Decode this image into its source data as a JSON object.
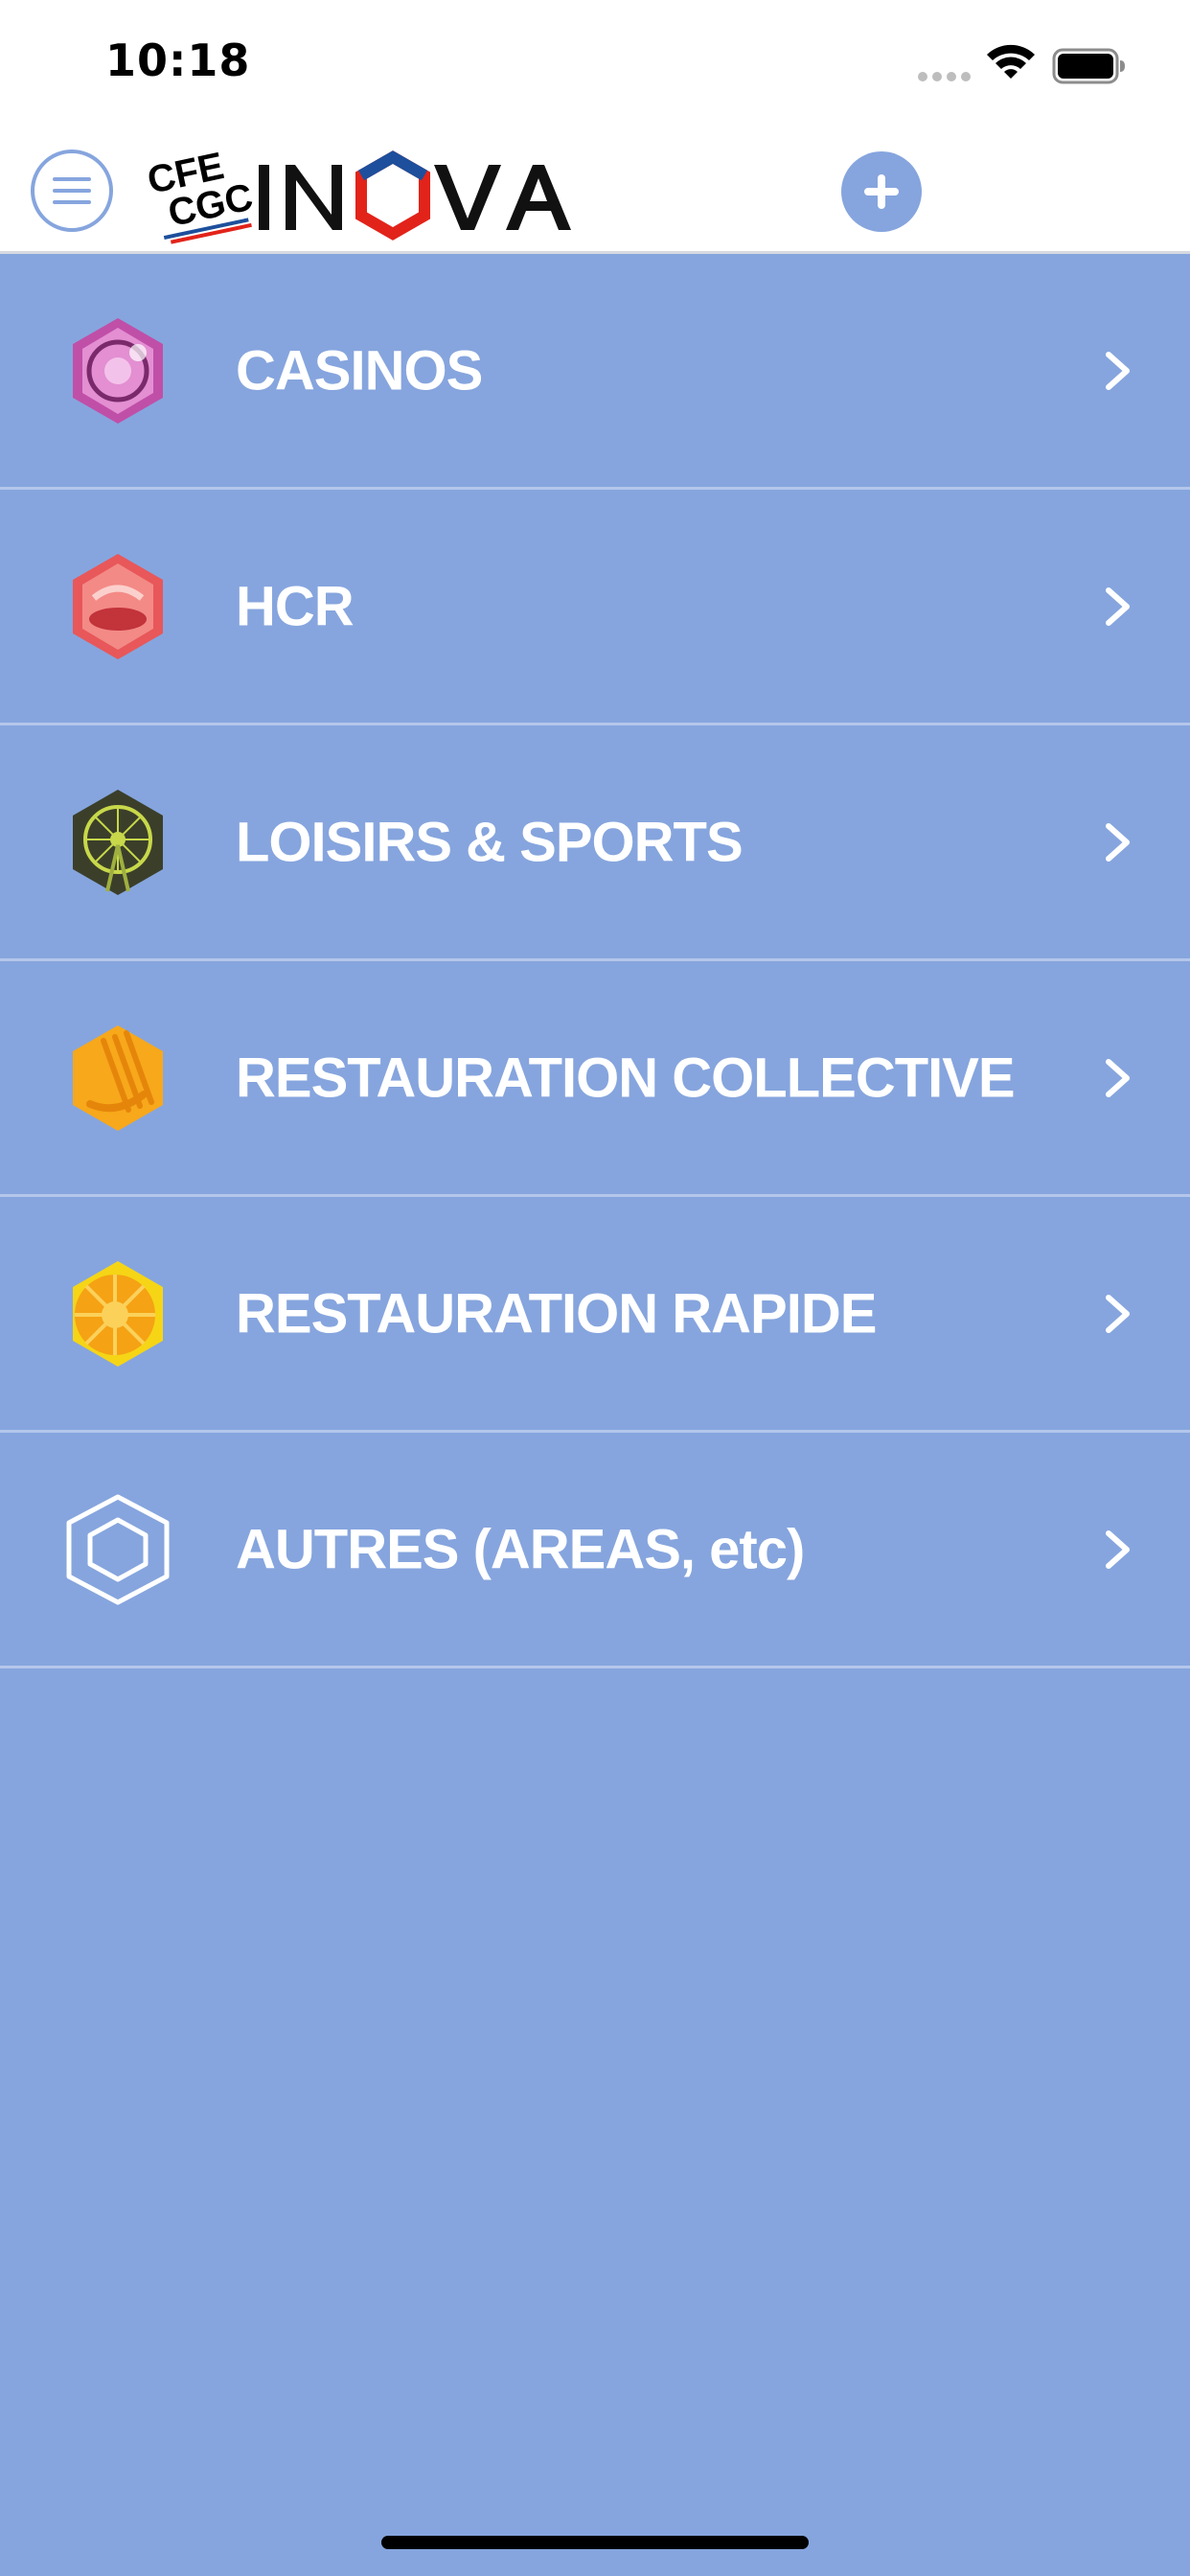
{
  "status_bar": {
    "time": "10:18"
  },
  "header": {
    "logo_text": "CFE CGC INOVA",
    "menu_icon": "hamburger-circle-icon",
    "add_icon": "plus-circle-icon",
    "colors": {
      "accent": "#86a5de",
      "logo_red": "#e2231a",
      "logo_blue": "#1d4f9c"
    }
  },
  "categories": [
    {
      "label": "CASINOS",
      "icon": "casino-hex-icon",
      "color": "#c04fa8"
    },
    {
      "label": "HCR",
      "icon": "hcr-hex-icon",
      "color": "#e8575a"
    },
    {
      "label": "LOISIRS & SPORTS",
      "icon": "ferris-wheel-hex-icon",
      "color": "#4d5a2a"
    },
    {
      "label": "RESTAURATION COLLECTIVE",
      "icon": "fork-hex-icon",
      "color": "#f7a81b"
    },
    {
      "label": "RESTAURATION RAPIDE",
      "icon": "tomato-hex-icon",
      "color": "#f5b014"
    },
    {
      "label": "AUTRES (AREAS, etc)",
      "icon": "outline-hex-icon",
      "color": "#ffffff"
    }
  ],
  "colors": {
    "background": "#86a5de",
    "separator": "#b4c6ea"
  }
}
